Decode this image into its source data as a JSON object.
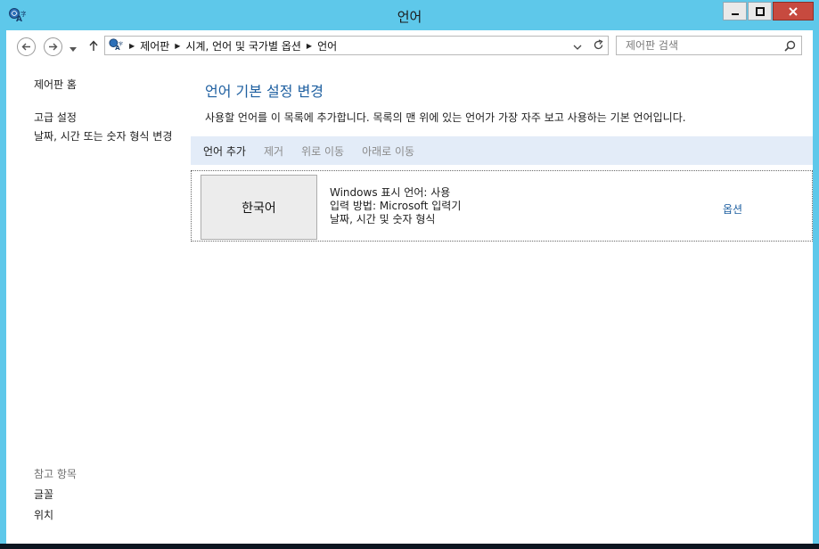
{
  "window": {
    "title": "언어",
    "icon": "control-panel-clock-language-icon",
    "colors": {
      "frame": "#5ec8ea",
      "close": "#c74a3f",
      "link": "#1e5fa0",
      "cmdbar": "#e3ecf8"
    }
  },
  "nav": {
    "breadcrumb": [
      "제어판",
      "시계, 언어 및 국가별 옵션",
      "언어"
    ],
    "search_placeholder": "제어판 검색"
  },
  "sidebar": {
    "home": "제어판 홈",
    "advanced": "고급 설정",
    "datetime": "날짜, 시간 또는 숫자 형식 변경",
    "see_also_title": "참고 항목",
    "see_also": [
      "글꼴",
      "위치"
    ]
  },
  "main": {
    "title": "언어 기본 설정 변경",
    "description": "사용할 언어를 이 목록에 추가합니다. 목록의 맨 위에 있는 언어가 가장 자주 보고 사용하는 기본 언어입니다.",
    "commands": [
      "언어 추가",
      "제거",
      "위로 이동",
      "아래로 이동"
    ]
  },
  "language": {
    "name": "한국어",
    "details": [
      "Windows 표시 언어: 사용",
      "입력 방법: Microsoft 입력기",
      "날짜, 시간 및 숫자 형식"
    ],
    "options": "옵션"
  }
}
